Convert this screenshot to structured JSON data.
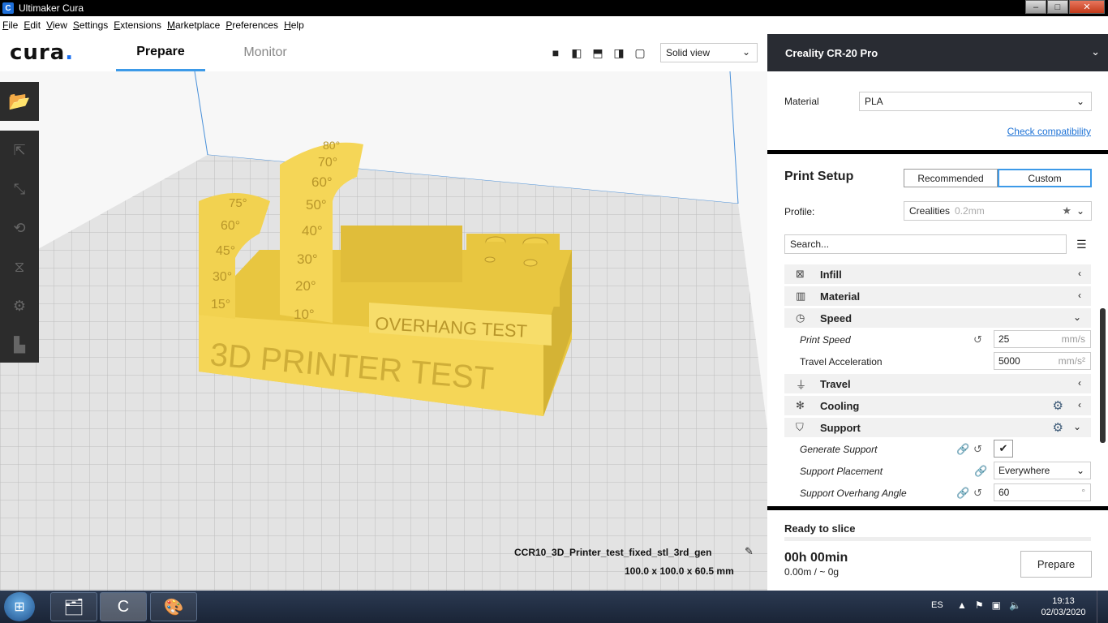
{
  "window": {
    "title": "Ultimaker Cura",
    "app_icon": "C"
  },
  "menu": [
    "File",
    "Edit",
    "View",
    "Settings",
    "Extensions",
    "Marketplace",
    "Preferences",
    "Help"
  ],
  "header": {
    "logo": "cura",
    "tabs": {
      "prepare": "Prepare",
      "monitor": "Monitor"
    },
    "view_mode": "Solid view"
  },
  "printer": {
    "name": "Creality CR-20 Pro"
  },
  "material": {
    "label": "Material",
    "value": "PLA",
    "check_link": "Check compatibility"
  },
  "print_setup": {
    "title": "Print Setup",
    "modes": {
      "recommended": "Recommended",
      "custom": "Custom"
    },
    "profile_label": "Profile:",
    "profile_value": "Crealities",
    "profile_layer": "0.2mm",
    "search_placeholder": "Search...",
    "categories": {
      "infill": "Infill",
      "material": "Material",
      "speed": "Speed",
      "travel": "Travel",
      "cooling": "Cooling",
      "support": "Support"
    },
    "settings": {
      "print_speed": {
        "label": "Print Speed",
        "value": "25",
        "unit": "mm/s"
      },
      "travel_accel": {
        "label": "Travel Acceleration",
        "value": "5000",
        "unit": "mm/s²"
      },
      "generate_support": {
        "label": "Generate Support",
        "checked": true
      },
      "support_placement": {
        "label": "Support Placement",
        "value": "Everywhere"
      },
      "support_overhang": {
        "label": "Support Overhang Angle",
        "value": "60",
        "unit": "°"
      }
    }
  },
  "slice": {
    "status": "Ready to slice",
    "time": "00h 00min",
    "estimate": "0.00m / ~ 0g",
    "button": "Prepare"
  },
  "model": {
    "name": "CCR10_3D_Printer_test_fixed_stl_3rd_gen",
    "dimensions": "100.0 x 100.0 x 60.5 mm",
    "texts": {
      "front": "3D PRINTER TEST",
      "overhang": "OVERHANG TEST",
      "arc_small": [
        "75°",
        "60°",
        "45°",
        "30°",
        "15°"
      ],
      "arc_large": [
        "80°",
        "70°",
        "60°",
        "50°",
        "40°",
        "30°",
        "20°",
        "10°"
      ]
    }
  },
  "taskbar": {
    "lang": "ES",
    "time": "19:13",
    "date": "02/03/2020"
  },
  "colors": {
    "accent": "#3d9ae8",
    "model": "#f5d657",
    "panel_dark": "#292c33"
  }
}
